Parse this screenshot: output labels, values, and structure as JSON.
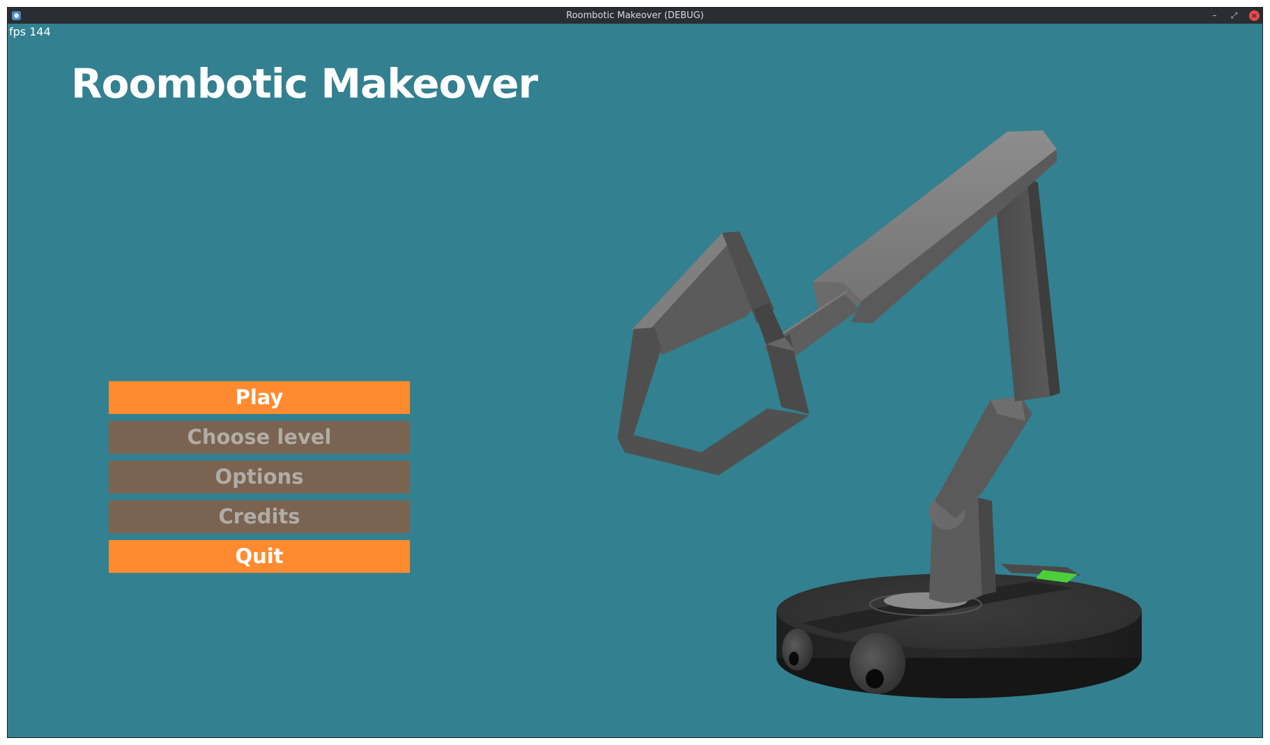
{
  "window": {
    "title": "Roombotic Makeover (DEBUG)",
    "minimize_icon": "minimize-icon",
    "maximize_icon": "maximize-icon",
    "close_icon": "close-icon",
    "minimize_glyph": "–",
    "maximize_glyph": "⤢",
    "close_glyph": "×"
  },
  "hud": {
    "fps": "fps 144"
  },
  "game": {
    "title": "Roombotic Makeover"
  },
  "menu": {
    "items": [
      {
        "label": "Play",
        "state": "active"
      },
      {
        "label": "Choose level",
        "state": "disabled"
      },
      {
        "label": "Options",
        "state": "disabled"
      },
      {
        "label": "Credits",
        "state": "disabled"
      },
      {
        "label": "Quit",
        "state": "active"
      }
    ]
  },
  "colors": {
    "background": "#338090",
    "button_active": "#ff8a2f",
    "button_disabled": "#7a6451",
    "text_active": "#ffffff",
    "text_disabled": "#b1aca6"
  }
}
